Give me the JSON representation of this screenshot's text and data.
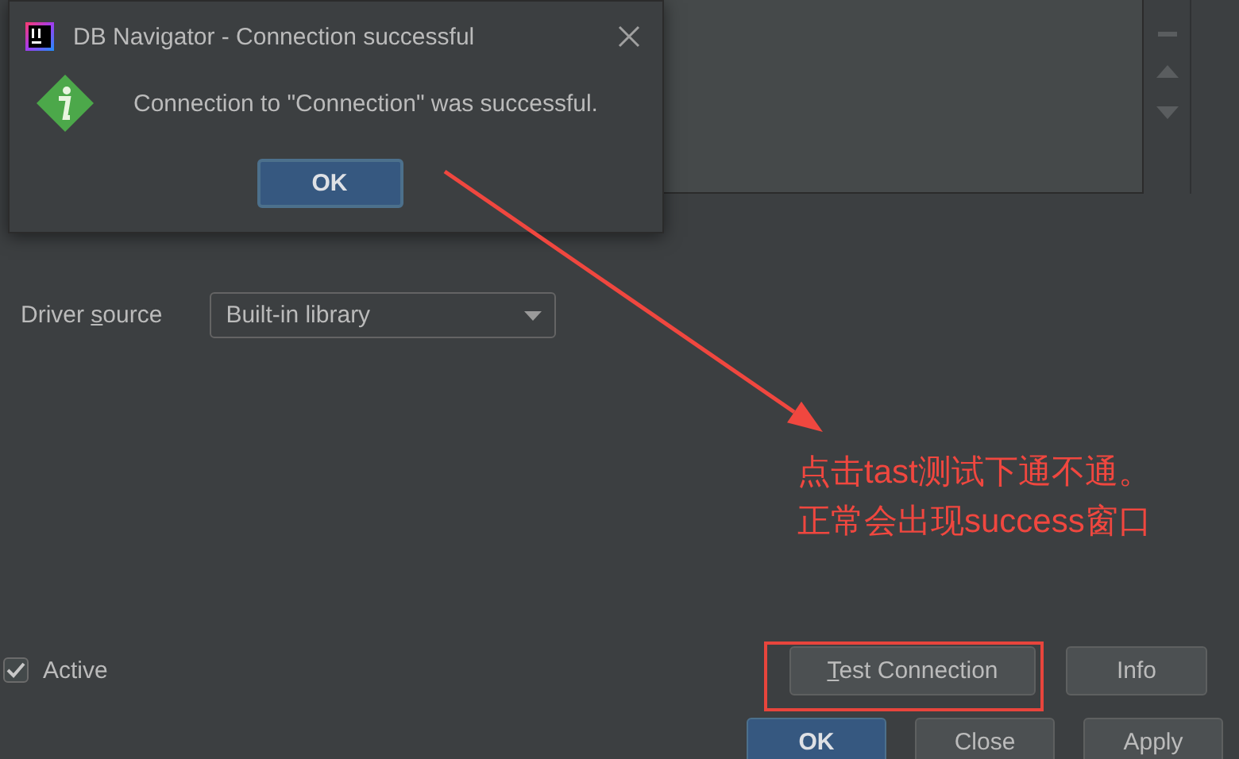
{
  "dialog": {
    "title": "DB Navigator - Connection successful",
    "message": "Connection to \"Connection\" was successful.",
    "buttons": [
      {
        "label": "OK",
        "default": true
      }
    ]
  },
  "driver_source": {
    "label": {
      "pre": "Driver ",
      "key": "s",
      "post": "ource"
    },
    "value": "Built-in library"
  },
  "active": {
    "label": "Active",
    "checked": true
  },
  "actions": [
    {
      "label": {
        "key": "T",
        "post": "est Connection"
      },
      "highlighted": true
    },
    {
      "label": {
        "pre": "Info"
      },
      "highlighted": false
    }
  ],
  "footer_buttons": [
    {
      "label": "OK",
      "default": true
    },
    {
      "label": "Close",
      "default": false
    },
    {
      "label": "Apply",
      "default": false
    }
  ],
  "annotation": {
    "lines": [
      "点击tast测试下通不通。",
      "正常会出现success窗口"
    ]
  }
}
